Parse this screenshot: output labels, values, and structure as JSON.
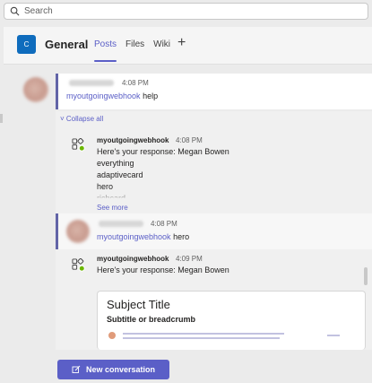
{
  "search": {
    "placeholder": "Search"
  },
  "channel": {
    "avatar_letter": "C",
    "name": "General",
    "tabs": [
      {
        "label": "Posts",
        "active": true
      },
      {
        "label": "Files",
        "active": false
      },
      {
        "label": "Wiki",
        "active": false
      }
    ],
    "add_tab_symbol": "+"
  },
  "posts": [
    {
      "time": "4:08 PM",
      "mention": "myoutgoingwebhook",
      "text": " help"
    }
  ],
  "thread": {
    "collapse_label": "Collapse all",
    "replies": [
      {
        "author": "myoutgoingwebhook",
        "time": "4:08 PM",
        "lines": [
          "Here's your response: Megan Bowen",
          "everything",
          "adaptivecard",
          "hero",
          "richcard"
        ],
        "see_more": "See more"
      },
      {
        "time": "4:08 PM",
        "mention": "myoutgoingwebhook",
        "text": " hero"
      },
      {
        "author": "myoutgoingwebhook",
        "time": "4:09 PM",
        "lines": [
          "Here's your response: Megan Bowen"
        ],
        "card": {
          "title": "Subject Title",
          "subtitle": "Subtitle or breadcrumb"
        }
      }
    ]
  },
  "footer": {
    "new_conversation_label": "New conversation"
  },
  "colors": {
    "brand": "#5b5fc7",
    "team_avatar": "#0f6cbd",
    "online": "#6bb700"
  }
}
